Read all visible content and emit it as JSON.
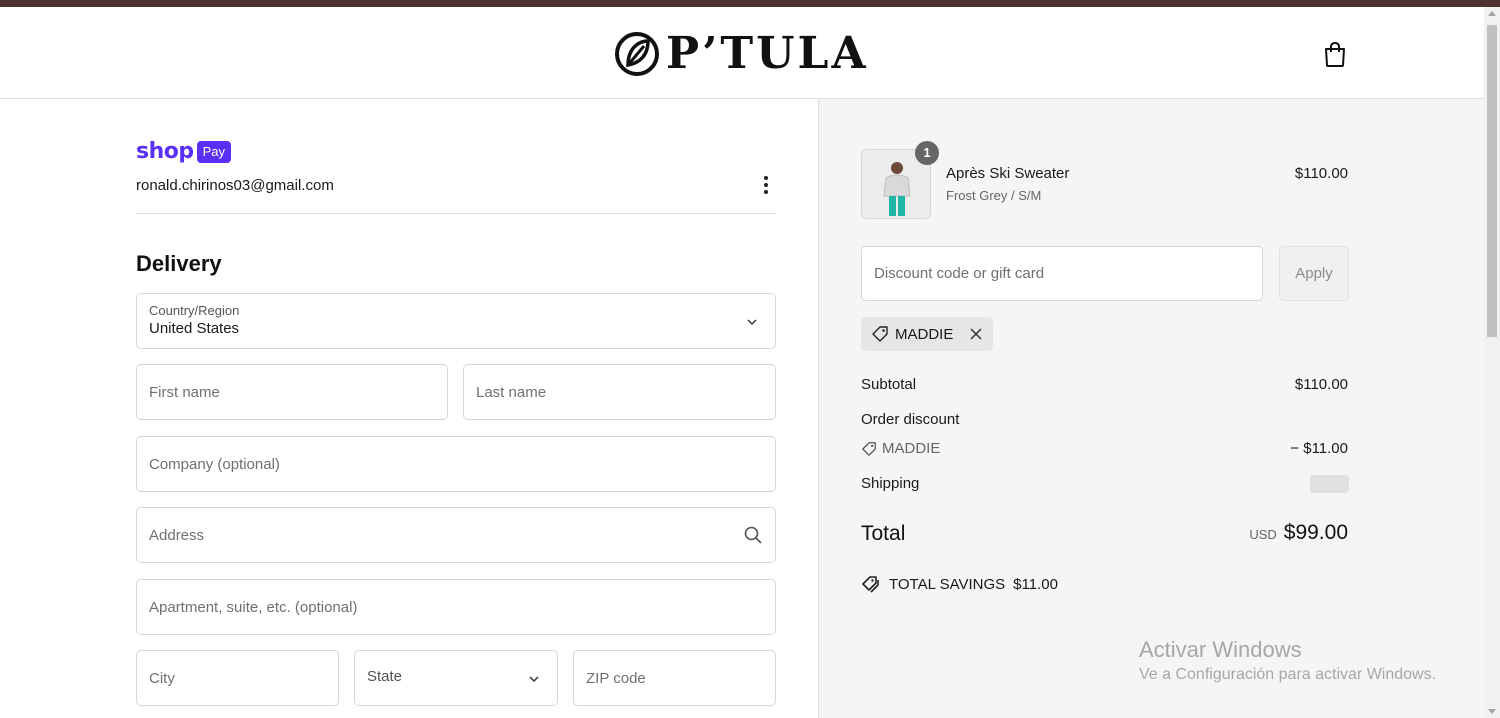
{
  "brand": {
    "name": "P’TULA"
  },
  "header": {
    "cart_icon": "shopping-bag-icon"
  },
  "express": {
    "shop_word": "shop",
    "pay_word": "Pay",
    "email": "ronald.chirinos03@gmail.com"
  },
  "delivery": {
    "title": "Delivery",
    "country": {
      "label": "Country/Region",
      "value": "United States"
    },
    "first_name": {
      "placeholder": "First name"
    },
    "last_name": {
      "placeholder": "Last name"
    },
    "company": {
      "placeholder": "Company (optional)"
    },
    "address": {
      "placeholder": "Address"
    },
    "apartment": {
      "placeholder": "Apartment, suite, etc. (optional)"
    },
    "city": {
      "placeholder": "City"
    },
    "state": {
      "placeholder": "State"
    },
    "zip": {
      "placeholder": "ZIP code"
    }
  },
  "summary": {
    "item": {
      "quantity": "1",
      "name": "Après Ski Sweater",
      "variant": "Frost Grey / S/M",
      "price": "$110.00"
    },
    "discount_input": {
      "placeholder": "Discount code or gift card"
    },
    "apply_label": "Apply",
    "applied_code": "MADDIE",
    "subtotal_label": "Subtotal",
    "subtotal_value": "$110.00",
    "order_discount_label": "Order discount",
    "order_discount_code": "MADDIE",
    "order_discount_value": "− $11.00",
    "shipping_label": "Shipping",
    "total_label": "Total",
    "total_currency": "USD",
    "total_value": "$99.00",
    "savings_label": "TOTAL SAVINGS",
    "savings_value": "$11.00"
  },
  "watermark": {
    "title": "Activar Windows",
    "subtitle": "Ve a Configuración para activar Windows."
  },
  "colors": {
    "shop_pay": "#5a31f4",
    "top_strip": "#4e3330",
    "summary_bg": "#f5f5f5"
  }
}
